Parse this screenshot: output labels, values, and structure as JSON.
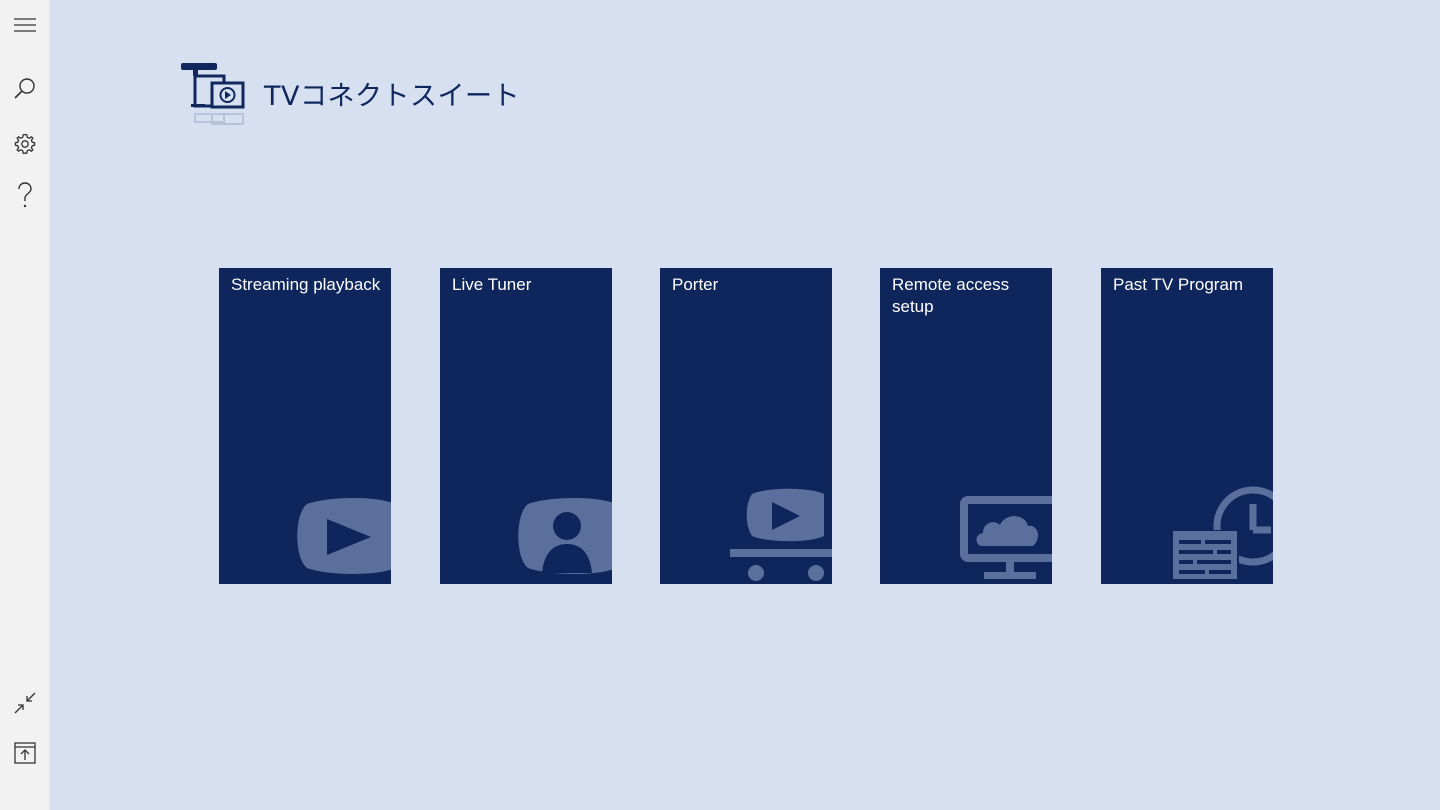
{
  "sidebar": {
    "top_icons": [
      "hamburger-menu-icon",
      "search-icon",
      "gear-icon",
      "help-question-icon"
    ],
    "bottom_icons": [
      "compact-overlay-icon",
      "upload-icon"
    ]
  },
  "header": {
    "title": "TVコネクトスイート",
    "logo_icon": "tv-connect-logo-icon"
  },
  "tiles": [
    {
      "label": "Streaming playback",
      "icon": "play-button-icon"
    },
    {
      "label": "Live Tuner",
      "icon": "person-screen-icon"
    },
    {
      "label": "Porter",
      "icon": "video-cart-icon"
    },
    {
      "label": "Remote access setup",
      "icon": "cloud-monitor-icon"
    },
    {
      "label": "Past TV Program",
      "icon": "schedule-clock-icon"
    }
  ],
  "colors": {
    "background": "#d6e0f0",
    "sidebar": "#f2f2f2",
    "tile": "#0f265c",
    "tile_icon": "#5b6f9c",
    "title": "#10275e"
  }
}
